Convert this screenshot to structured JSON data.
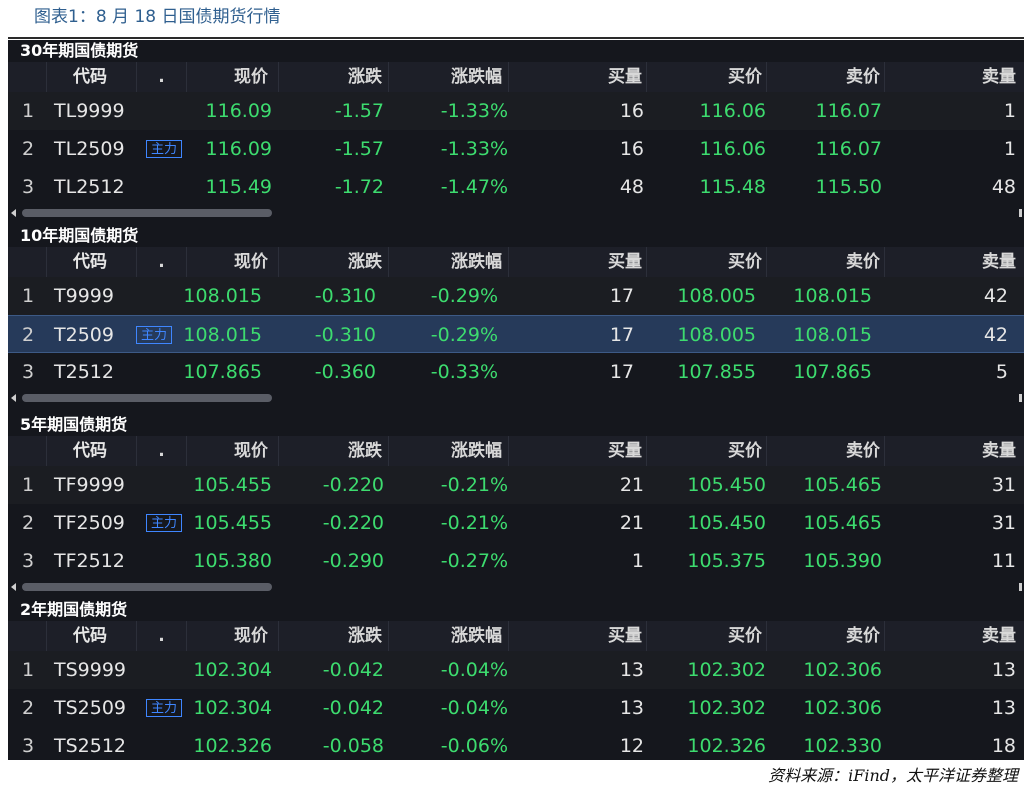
{
  "caption": "图表1：8 月 18 日国债期货行情",
  "footer": "资料来源：iFind，太平洋证券整理",
  "columns": {
    "code": "代码",
    "dot": ".",
    "price": "现价",
    "change": "涨跌",
    "change_pct": "涨跌幅",
    "bid_vol": "买量",
    "bid": "买价",
    "ask": "卖价",
    "ask_vol": "卖量"
  },
  "sections": [
    {
      "title": "30年期国债期货",
      "rows": [
        {
          "idx": "1",
          "code": "TL9999",
          "tag": "",
          "price": "116.09",
          "change": "-1.57",
          "pct": "-1.33%",
          "bid_vol": "16",
          "bid": "116.06",
          "ask": "116.07",
          "ask_vol": "1"
        },
        {
          "idx": "2",
          "code": "TL2509",
          "tag": "主力",
          "price": "116.09",
          "change": "-1.57",
          "pct": "-1.33%",
          "bid_vol": "16",
          "bid": "116.06",
          "ask": "116.07",
          "ask_vol": "1"
        },
        {
          "idx": "3",
          "code": "TL2512",
          "tag": "",
          "price": "115.49",
          "change": "-1.72",
          "pct": "-1.47%",
          "bid_vol": "48",
          "bid": "115.48",
          "ask": "115.50",
          "ask_vol": "48"
        }
      ]
    },
    {
      "title": "10年期国债期货",
      "rows": [
        {
          "idx": "1",
          "code": "T9999",
          "tag": "",
          "price": "108.015",
          "change": "-0.310",
          "pct": "-0.29%",
          "bid_vol": "17",
          "bid": "108.005",
          "ask": "108.015",
          "ask_vol": "42"
        },
        {
          "idx": "2",
          "code": "T2509",
          "tag": "主力",
          "price": "108.015",
          "change": "-0.310",
          "pct": "-0.29%",
          "bid_vol": "17",
          "bid": "108.005",
          "ask": "108.015",
          "ask_vol": "42"
        },
        {
          "idx": "3",
          "code": "T2512",
          "tag": "",
          "price": "107.865",
          "change": "-0.360",
          "pct": "-0.33%",
          "bid_vol": "17",
          "bid": "107.855",
          "ask": "107.865",
          "ask_vol": "5"
        }
      ]
    },
    {
      "title": "5年期国债期货",
      "rows": [
        {
          "idx": "1",
          "code": "TF9999",
          "tag": "",
          "price": "105.455",
          "change": "-0.220",
          "pct": "-0.21%",
          "bid_vol": "21",
          "bid": "105.450",
          "ask": "105.465",
          "ask_vol": "31"
        },
        {
          "idx": "2",
          "code": "TF2509",
          "tag": "主力",
          "price": "105.455",
          "change": "-0.220",
          "pct": "-0.21%",
          "bid_vol": "21",
          "bid": "105.450",
          "ask": "105.465",
          "ask_vol": "31"
        },
        {
          "idx": "3",
          "code": "TF2512",
          "tag": "",
          "price": "105.380",
          "change": "-0.290",
          "pct": "-0.27%",
          "bid_vol": "1",
          "bid": "105.375",
          "ask": "105.390",
          "ask_vol": "11"
        }
      ]
    },
    {
      "title": "2年期国债期货",
      "rows": [
        {
          "idx": "1",
          "code": "TS9999",
          "tag": "",
          "price": "102.304",
          "change": "-0.042",
          "pct": "-0.04%",
          "bid_vol": "13",
          "bid": "102.302",
          "ask": "102.306",
          "ask_vol": "13"
        },
        {
          "idx": "2",
          "code": "TS2509",
          "tag": "主力",
          "price": "102.304",
          "change": "-0.042",
          "pct": "-0.04%",
          "bid_vol": "13",
          "bid": "102.302",
          "ask": "102.306",
          "ask_vol": "13"
        },
        {
          "idx": "3",
          "code": "TS2512",
          "tag": "",
          "price": "102.326",
          "change": "-0.058",
          "pct": "-0.06%",
          "bid_vol": "12",
          "bid": "102.326",
          "ask": "102.330",
          "ask_vol": "18"
        }
      ]
    }
  ]
}
